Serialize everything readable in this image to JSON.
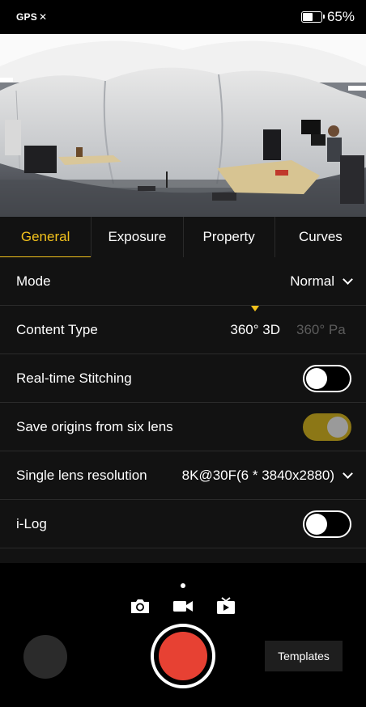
{
  "status_bar": {
    "gps_label": "GPS",
    "gps_status_symbol": "✕",
    "battery_percent_text": "65%",
    "battery_level": 0.65
  },
  "tabs": [
    {
      "label": "General",
      "active": true
    },
    {
      "label": "Exposure",
      "active": false
    },
    {
      "label": "Property",
      "active": false
    },
    {
      "label": "Curves",
      "active": false
    }
  ],
  "settings": {
    "mode": {
      "label": "Mode",
      "value": "Normal"
    },
    "content_type": {
      "label": "Content Type",
      "selected": "360° 3D",
      "next_option": "360° Pa"
    },
    "realtime_stitching": {
      "label": "Real-time Stitching",
      "on": false
    },
    "save_origins": {
      "label": "Save origins from six lens",
      "on": true
    },
    "single_lens_resolution": {
      "label": "Single lens resolution",
      "value": "8K@30F(6 * 3840x2880)"
    },
    "ilog": {
      "label": "i-Log",
      "on": false
    }
  },
  "capture": {
    "modes": [
      "photo",
      "video",
      "live"
    ],
    "selected_mode": "video",
    "templates_label": "Templates"
  },
  "colors": {
    "accent": "#f2c11c",
    "record": "#e74133",
    "toggle_on": "#8c7716",
    "panel_bg": "#121212"
  }
}
